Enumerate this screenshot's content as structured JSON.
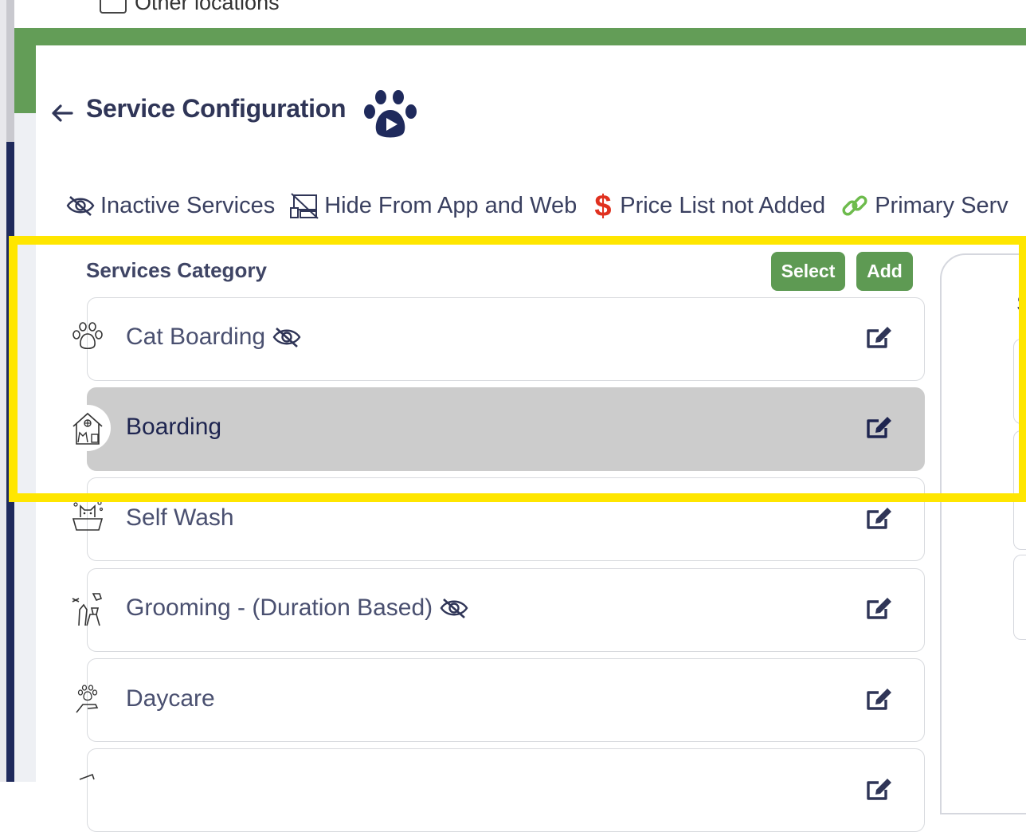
{
  "top": {
    "other_locations_label": "Other locations"
  },
  "header": {
    "title": "Service Configuration"
  },
  "legend": [
    {
      "label": "Inactive Services",
      "icon": "eye-slash-icon"
    },
    {
      "label": "Hide From App and Web",
      "icon": "hidden-devices-icon"
    },
    {
      "label": "Price List not Added",
      "icon": "dollar-icon"
    },
    {
      "label": "Primary Serv",
      "icon": "link-icon"
    }
  ],
  "services": {
    "header": "Services Category",
    "select_label": "Select",
    "add_label": "Add",
    "items": [
      {
        "label": "Cat Boarding",
        "icon": "paw-outline-icon",
        "inactive": true,
        "selected": false
      },
      {
        "label": "Boarding",
        "icon": "pet-house-icon",
        "inactive": false,
        "selected": true
      },
      {
        "label": "Self Wash",
        "icon": "pet-bath-icon",
        "inactive": false,
        "selected": false
      },
      {
        "label": "Grooming - (Duration Based)",
        "icon": "grooming-icon",
        "inactive": true,
        "selected": false
      },
      {
        "label": "Daycare",
        "icon": "hand-paw-icon",
        "inactive": false,
        "selected": false
      }
    ]
  },
  "right_panel": {
    "partial_text": "S"
  },
  "colors": {
    "brand_green": "#639d57",
    "button_green": "#5e9a53",
    "navy": "#1f2a5c",
    "highlight": "#ffe600",
    "dollar_red": "#e0311f",
    "link_green": "#6dbb4c"
  }
}
